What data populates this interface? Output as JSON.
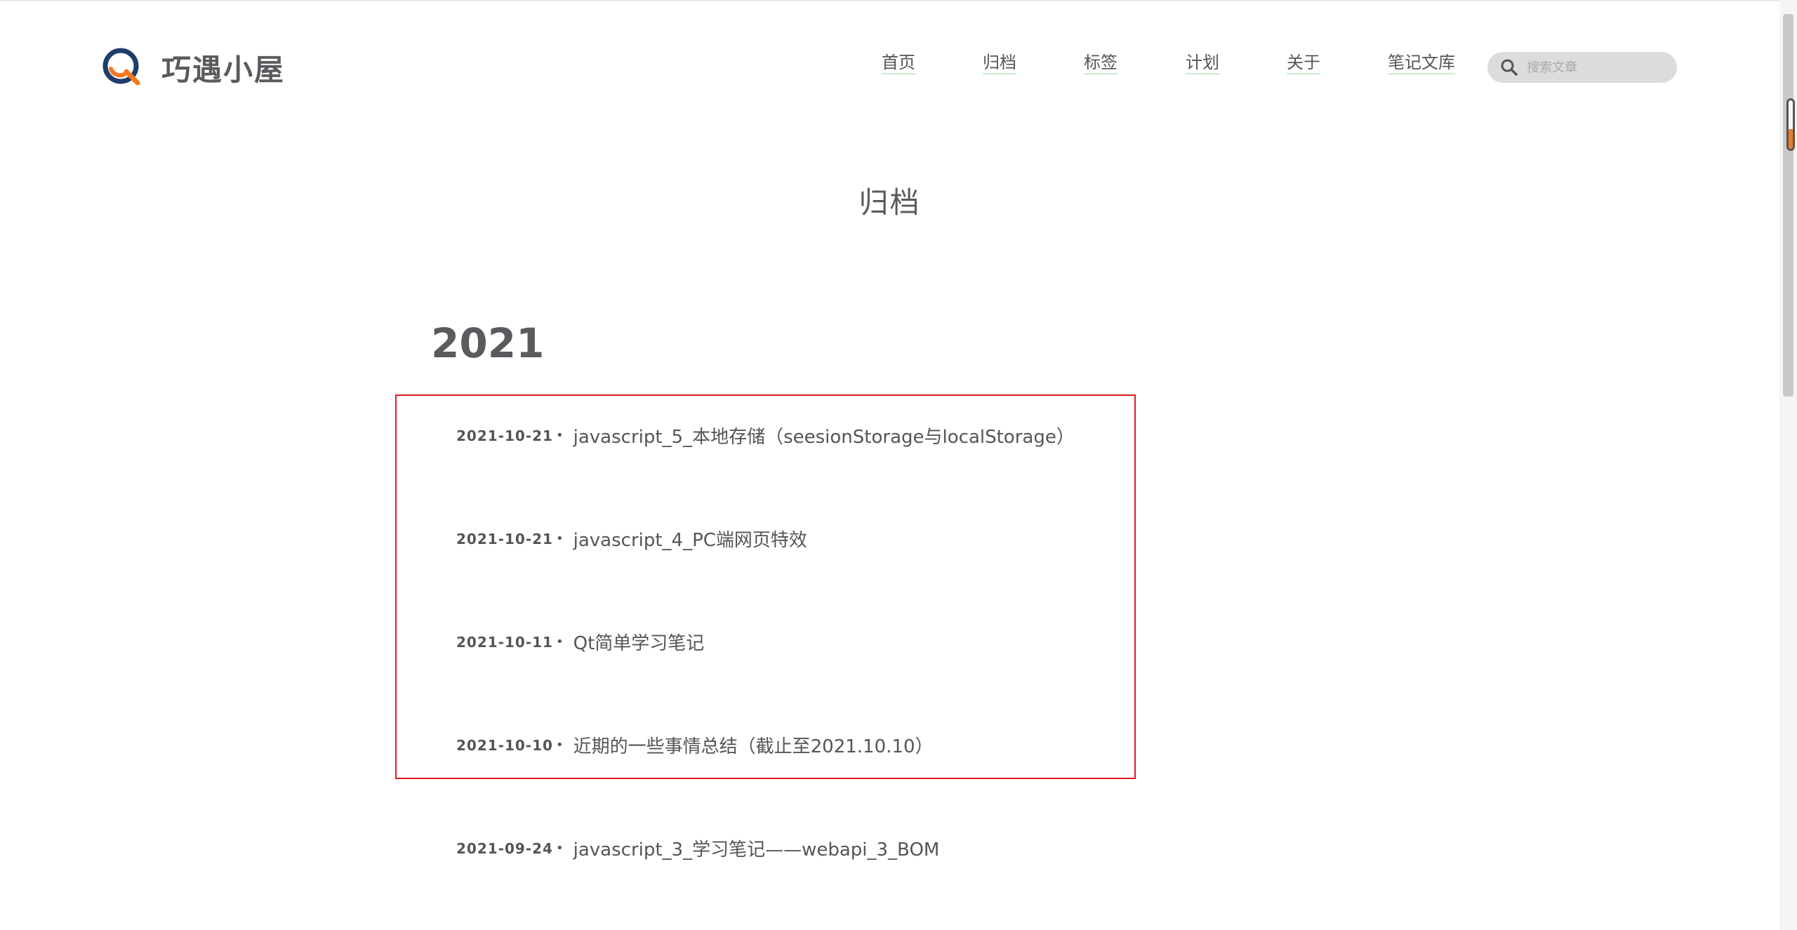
{
  "site": {
    "name": "巧遇小屋"
  },
  "nav": {
    "items": [
      {
        "label": "首页"
      },
      {
        "label": "归档"
      },
      {
        "label": "标签"
      },
      {
        "label": "计划"
      },
      {
        "label": "关于"
      },
      {
        "label": "笔记文库"
      }
    ]
  },
  "search": {
    "placeholder": "搜索文章"
  },
  "page": {
    "title": "归档"
  },
  "archive": {
    "year": "2021",
    "posts": [
      {
        "date": "2021-10-21",
        "title": "javascript_5_本地存储（seesionStorage与localStorage）"
      },
      {
        "date": "2021-10-21",
        "title": "javascript_4_PC端网页特效"
      },
      {
        "date": "2021-10-11",
        "title": "Qt简单学习笔记"
      },
      {
        "date": "2021-10-10",
        "title": "近期的一些事情总结（截止至2021.10.10）"
      },
      {
        "date": "2021-09-24",
        "title": "javascript_3_学习笔记——webapi_3_BOM"
      }
    ],
    "bullet": "•"
  },
  "colors": {
    "logo_blue": "#1f3d6b",
    "logo_orange": "#f47920",
    "highlight_border": "#e01b24",
    "nav_underline": "#c8ecd2"
  }
}
